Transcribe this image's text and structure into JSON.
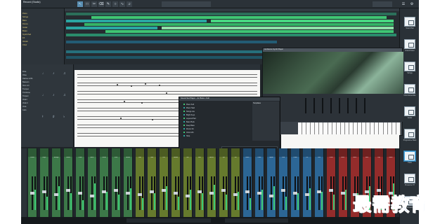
{
  "app": {
    "song_title": "Record (Studio)"
  },
  "toolbar": {
    "tools": [
      "arrow-icon",
      "range-icon",
      "split-icon",
      "erase-icon",
      "paint-icon",
      "mute-icon",
      "bend-icon",
      "listen-icon"
    ]
  },
  "arrange": {
    "tracks": [
      "Piano",
      "Strings",
      "Bass",
      "Drums",
      "Guitar",
      "Brass",
      "Synth Pad",
      "FX",
      "Vocals",
      "Choir"
    ]
  },
  "browser": {
    "presets": [
      "Sound Set",
      "Grand Piano",
      "Strings",
      "Choir Ensemble",
      "Guitar",
      "Progressive Bass",
      "Pads",
      "Presence XT",
      "Orchestra"
    ]
  },
  "score": {
    "instrument_list": [
      "Flute",
      "Oboe",
      "Clarinet in Bb",
      "Bassoon",
      "Horn in F",
      "Trumpet",
      "Trombone",
      "Timpani",
      "Violin I",
      "Violin II",
      "Viola",
      "Cello"
    ]
  },
  "synth": {
    "title": "Ambience Synth Player"
  },
  "instrument_dialog": {
    "title": "Sound Set Player - 4x Piano • Full",
    "rows": [
      "Piano Soft",
      "Piano Hard",
      "Strings Lite",
      "Bright Keys",
      "Layered Pad",
      "Bass Pluck",
      "Deep Bass",
      "Drums Kit",
      "Choir Ahh",
      "Harp"
    ],
    "panel_label": "Templates"
  },
  "mixer": {
    "channels": [
      "Piano",
      "Keys",
      "Strings",
      "Violas",
      "Cello",
      "Bass",
      "Drum",
      "Kick",
      "Snare",
      "Hat",
      "Tom",
      "OH",
      "Room",
      "Gtr",
      "Gtr2",
      "Brass",
      "Tpt",
      "Trb",
      "Horn",
      "Flute",
      "Synth",
      "Pad",
      "Lead",
      "FX",
      "Vox",
      "Choir",
      "Bus1",
      "Bus2",
      "Rev",
      "Dly",
      "Main"
    ]
  },
  "watermark": {
    "text": "最需教育"
  },
  "colors": {
    "background": "#1f2428",
    "clip_green": "#3fc774",
    "clip_teal": "#2aa6a2",
    "mixer_green": "#3e7d4a",
    "mixer_blue": "#2d6a9b",
    "mixer_red": "#9b2d2b",
    "logo_blue": "#1e6df2"
  }
}
